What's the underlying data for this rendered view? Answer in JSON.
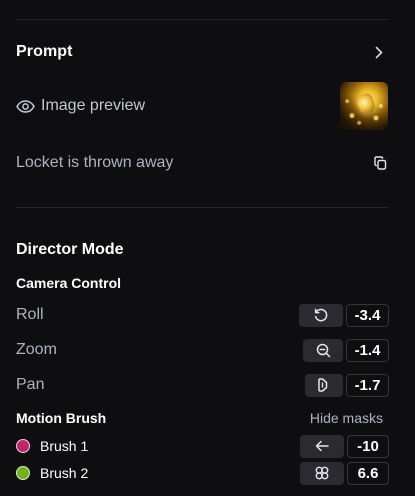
{
  "prompt": {
    "title": "Prompt",
    "preview_label": "Image preview",
    "text": "Locket is thrown away"
  },
  "director": {
    "title": "Director Mode",
    "camera_control": {
      "title": "Camera Control",
      "params": [
        {
          "label": "Roll",
          "icon": "rotate-ccw-icon",
          "value": "-3.4"
        },
        {
          "label": "Zoom",
          "icon": "zoom-out-icon",
          "value": "-1.4"
        },
        {
          "label": "Pan",
          "icon": "pan-icon",
          "value": "-1.7"
        }
      ]
    },
    "motion_brush": {
      "title": "Motion Brush",
      "hide_masks_label": "Hide masks",
      "brushes": [
        {
          "label": "Brush 1",
          "color": "#c0266e",
          "icon": "arrow-left-icon",
          "value": "-10"
        },
        {
          "label": "Brush 2",
          "color": "#74b21b",
          "icon": "clover-icon",
          "value": "6.6"
        }
      ]
    }
  }
}
